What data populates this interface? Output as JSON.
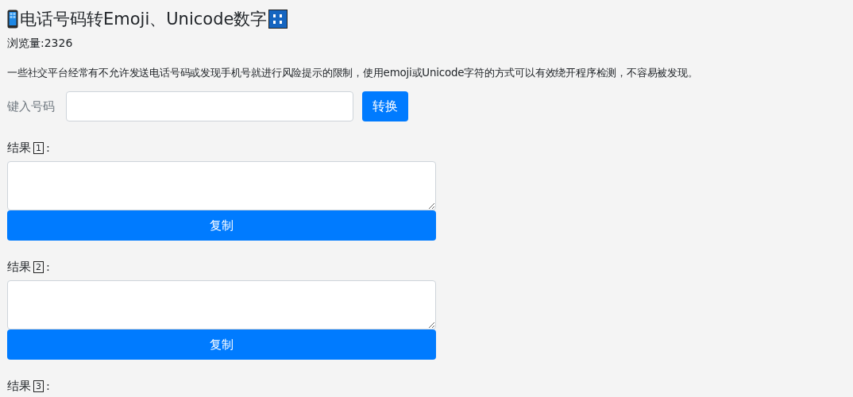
{
  "title": "电话号码转Emoji、Unicode数字",
  "views": "浏览量:2326",
  "description": "一些社交平台经常有不允许发送电话号码或发现手机号就进行风险提示的限制，使用emoji或Unicode字符的方式可以有效绕开程序检测，不容易被发现。",
  "input": {
    "label": "键入号码",
    "button": "转换"
  },
  "results": [
    {
      "label": "结果",
      "digit": "1",
      "colon": ":",
      "button": "复制"
    },
    {
      "label": "结果",
      "digit": "2",
      "colon": ":",
      "button": "复制"
    },
    {
      "label": "结果",
      "digit": "3",
      "colon": ":"
    }
  ]
}
